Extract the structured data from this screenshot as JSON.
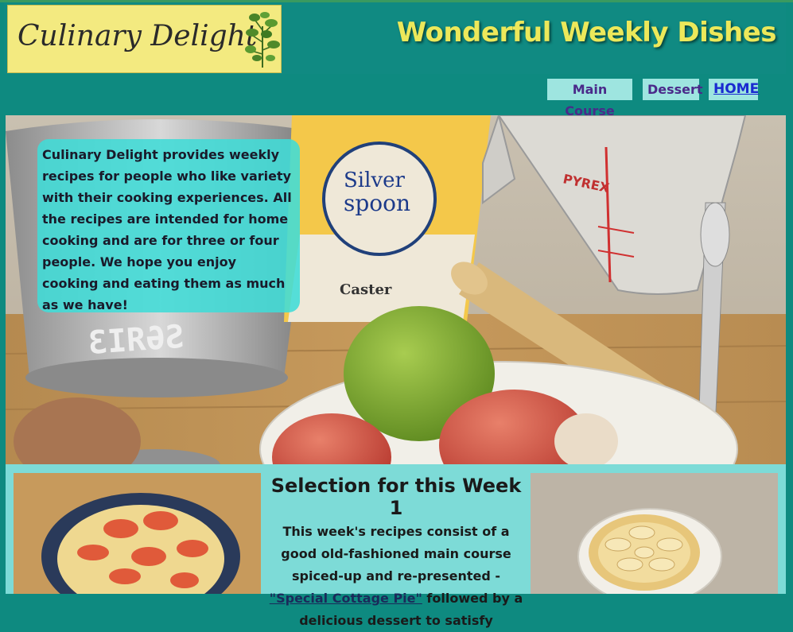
{
  "brand": {
    "logo_text": "Culinary Delight",
    "title": "Wonderful Weekly Dishes"
  },
  "nav": {
    "main_course": "Main Course",
    "dessert": "Dessert",
    "home": "HOME"
  },
  "intro": {
    "text": "Culinary Delight provides weekly recipes for people who like variety with their cooking experiences. All the recipes are intended for home cooking and are for three or four people. We hope you enjoy cooking and eating them as much as we have!"
  },
  "selection": {
    "title": "Selection for this Week 1",
    "text_before": "This week's recipes consist of a good old-fashioned main course spiced-up and re-presented - ",
    "link": "\"Special Cottage Pie\"",
    "text_after": " followed by a delicious dessert to satisfy"
  },
  "hero_image": {
    "package_brand": "Silver spoon",
    "package_label": "Caster",
    "jug_brand": "PYREX"
  },
  "colors": {
    "background": "#0e8a80",
    "logo_bg": "#f3ea80",
    "title": "#ece85a",
    "nav_bg": "#9ee5e0",
    "panel": "#7ddbd7"
  }
}
